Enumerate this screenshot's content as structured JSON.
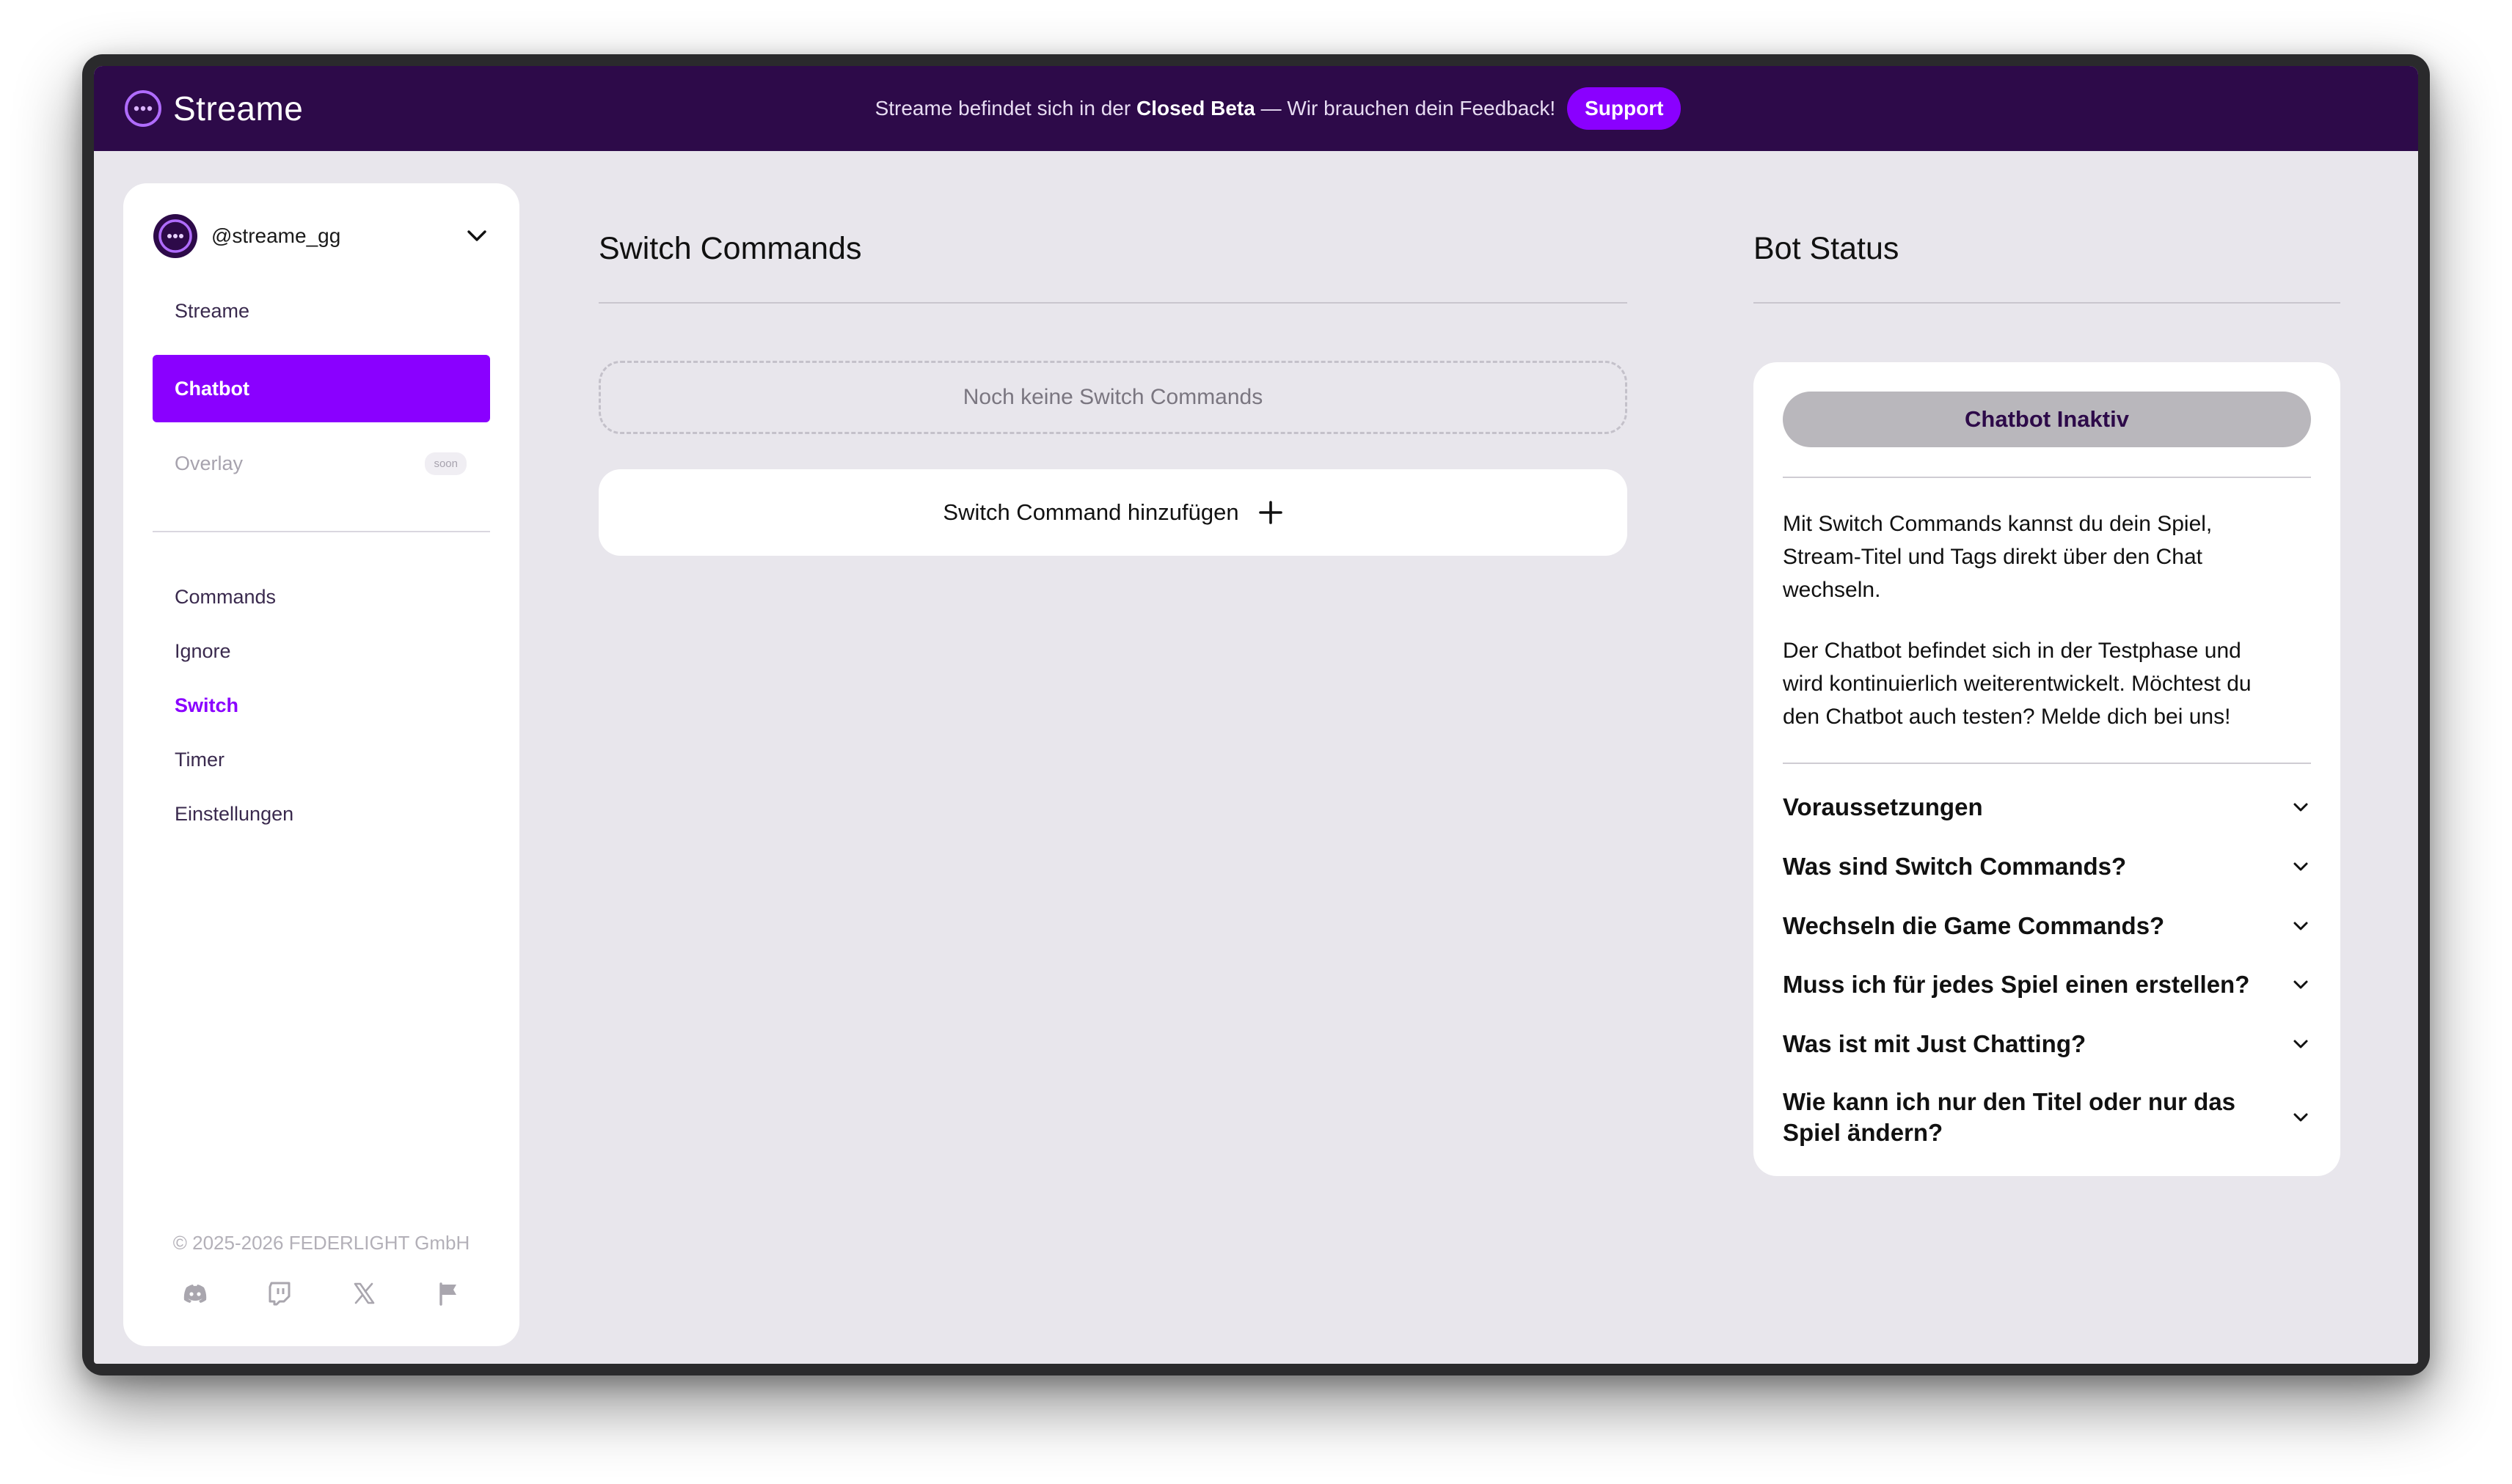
{
  "brand": {
    "name": "Streame"
  },
  "banner": {
    "prefix": "Streame befindet sich in der",
    "highlight": "Closed Beta",
    "suffix": "— Wir brauchen dein Feedback!",
    "support_label": "Support"
  },
  "sidebar": {
    "account": "@streame_gg",
    "nav": [
      {
        "label": "Streame",
        "state": "normal"
      },
      {
        "label": "Chatbot",
        "state": "active"
      },
      {
        "label": "Overlay",
        "state": "disabled",
        "badge": "soon"
      }
    ],
    "sub_nav": [
      {
        "label": "Commands",
        "active": false
      },
      {
        "label": "Ignore",
        "active": false
      },
      {
        "label": "Switch",
        "active": true
      },
      {
        "label": "Timer",
        "active": false
      },
      {
        "label": "Einstellungen",
        "active": false
      }
    ],
    "copyright": "© 2025-2026 FEDERLIGHT GmbH",
    "socials": [
      "discord-icon",
      "twitch-icon",
      "x-icon",
      "flag-icon"
    ]
  },
  "main": {
    "title": "Switch Commands",
    "empty_text": "Noch keine Switch Commands",
    "add_label": "Switch Command hinzufügen"
  },
  "bot": {
    "title": "Bot Status",
    "status": "Chatbot Inaktiv",
    "para1_lines": [
      "Mit Switch Commands kannst du dein Spiel,",
      "Stream-Titel und Tags direkt über den Chat",
      "wechseln."
    ],
    "para2_lines": [
      "Der Chatbot befindet sich in der Testphase und",
      "wird kontinuierlich weiterentwickelt. Möchtest du",
      "den Chatbot auch testen? Melde dich bei uns!"
    ],
    "faq": [
      "Voraussetzungen",
      "Was sind Switch Commands?",
      "Wechseln die Game Commands?",
      "Muss ich für jedes Spiel einen erstellen?",
      "Was ist mit Just Chatting?",
      "Wie kann ich nur den Titel oder nur das Spiel ändern?"
    ]
  },
  "colors": {
    "topbar": "#2d0a49",
    "accent": "#8a00ff",
    "background": "#e8e6ec",
    "status_inactive": "#b9b7bc"
  }
}
